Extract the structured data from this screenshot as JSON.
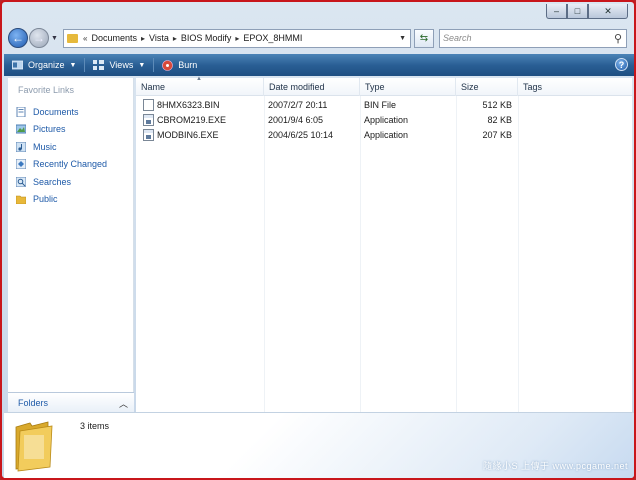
{
  "window": {
    "caption": {
      "minimize": "–",
      "maximize": "□",
      "close": "✕"
    }
  },
  "address_bar": {
    "prefix": "«",
    "crumbs": [
      "Documents",
      "Vista",
      "BIOS Modify",
      "EPOX_8HMMI"
    ],
    "separator": "▸",
    "search_placeholder": "Search"
  },
  "toolbar": {
    "organize": "Organize",
    "views": "Views",
    "burn": "Burn",
    "help": "?"
  },
  "sidebar": {
    "title": "Favorite Links",
    "items": [
      {
        "label": "Documents",
        "icon": "documents-icon"
      },
      {
        "label": "Pictures",
        "icon": "pictures-icon"
      },
      {
        "label": "Music",
        "icon": "music-icon"
      },
      {
        "label": "Recently Changed",
        "icon": "recent-icon"
      },
      {
        "label": "Searches",
        "icon": "searches-icon"
      },
      {
        "label": "Public",
        "icon": "public-folder-icon"
      }
    ],
    "folders_label": "Folders"
  },
  "columns": {
    "name": "Name",
    "date_modified": "Date modified",
    "type": "Type",
    "size": "Size",
    "tags": "Tags"
  },
  "files": [
    {
      "name": "8HMX6323.BIN",
      "date": "2007/2/7 20:11",
      "type": "BIN File",
      "size": "512 KB",
      "icon": "file-icon"
    },
    {
      "name": "CBROM219.EXE",
      "date": "2001/9/4 6:05",
      "type": "Application",
      "size": "82 KB",
      "icon": "exe-icon"
    },
    {
      "name": "MODBIN6.EXE",
      "date": "2004/6/25 10:14",
      "type": "Application",
      "size": "207 KB",
      "icon": "exe-icon"
    }
  ],
  "details": {
    "items_count": "3 items",
    "watermark": "隨緣小S 上傳于 www.pcgame.net"
  },
  "colors": {
    "frame": "#c8161b",
    "toolbar": "#2a5f95",
    "link": "#1e5aa8"
  }
}
